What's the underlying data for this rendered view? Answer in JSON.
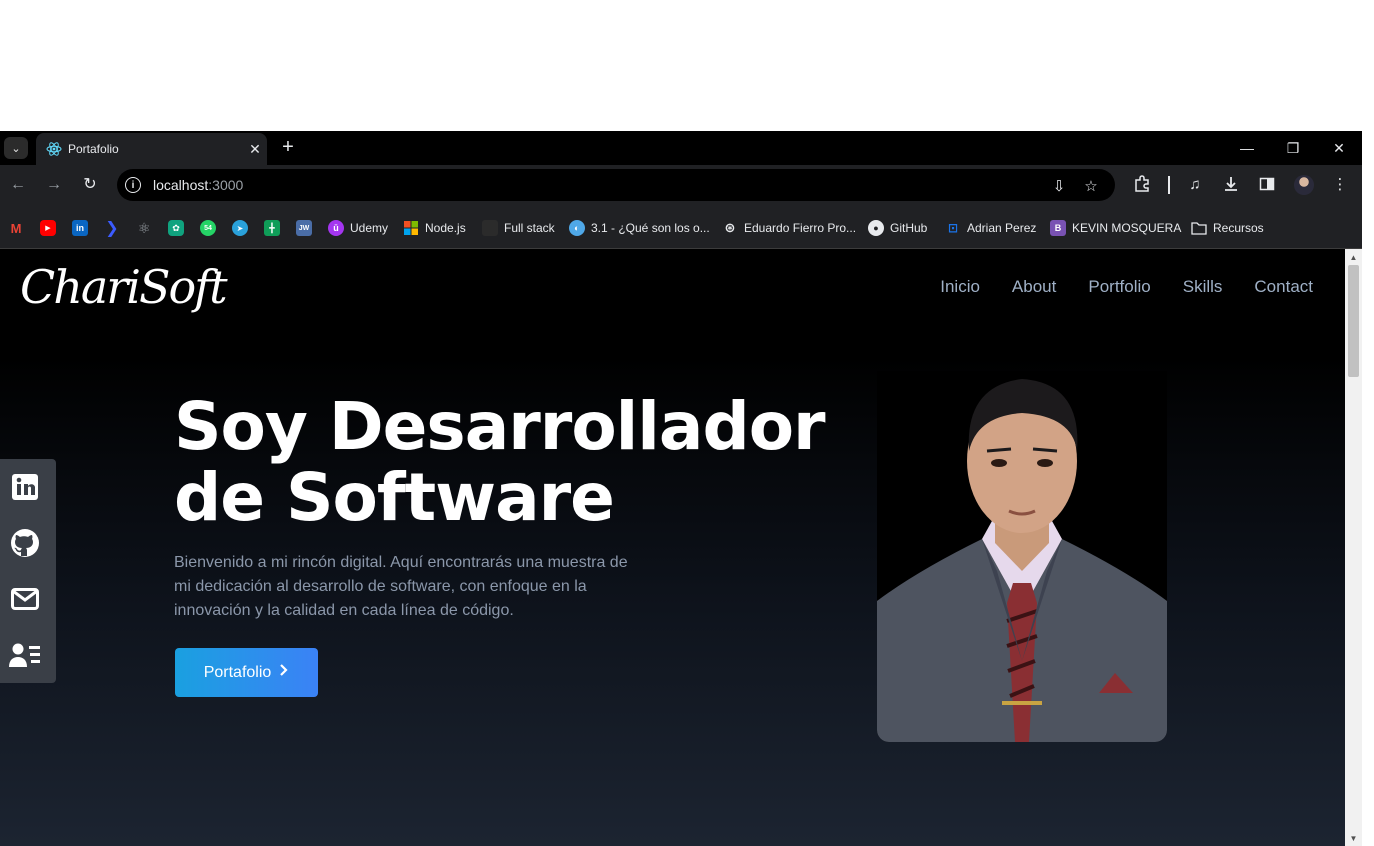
{
  "browser": {
    "tab": {
      "title": "Portafolio"
    },
    "url": {
      "host": "localhost",
      "port": ":3000"
    },
    "bookmarks": [
      {
        "label": "",
        "icon": "gmail-icon"
      },
      {
        "label": "",
        "icon": "youtube-icon"
      },
      {
        "label": "",
        "icon": "linkedin-icon"
      },
      {
        "label": "",
        "icon": "chevron-app-icon"
      },
      {
        "label": "",
        "icon": "react-icon"
      },
      {
        "label": "",
        "icon": "chatgpt-icon"
      },
      {
        "label": "",
        "icon": "whatsapp-icon"
      },
      {
        "label": "",
        "icon": "telegram-icon"
      },
      {
        "label": "",
        "icon": "sheets-icon"
      },
      {
        "label": "",
        "icon": "jw-icon"
      },
      {
        "label": "Udemy",
        "icon": "udemy-icon"
      },
      {
        "label": "Node.js",
        "icon": "microsoft-icon"
      },
      {
        "label": "Full stack",
        "icon": "square-icon"
      },
      {
        "label": "3.1 - ¿Qué son los o...",
        "icon": "circle-icon"
      },
      {
        "label": "Eduardo Fierro Pro...",
        "icon": "openai-icon"
      },
      {
        "label": "GitHub",
        "icon": "github-icon"
      },
      {
        "label": "Adrian Perez",
        "icon": "classroom-icon"
      },
      {
        "label": "KEVIN MOSQUERA",
        "icon": "bootstrap-icon"
      },
      {
        "label": "Recursos",
        "icon": "folder-icon"
      }
    ]
  },
  "site": {
    "logo": "ChariSoft",
    "nav": [
      "Inicio",
      "About",
      "Portfolio",
      "Skills",
      "Contact"
    ],
    "hero": {
      "title_line1": "Soy Desarrollador",
      "title_line2": "de Software",
      "description": "Bienvenido a mi rincón digital. Aquí encontrarás una muestra de mi dedicación al desarrollo de software, con enfoque en la innovación y la calidad en cada línea de código.",
      "cta": "Portafolio"
    },
    "social": [
      "linkedin-icon",
      "github-icon",
      "mail-icon",
      "resume-icon"
    ]
  },
  "colors": {
    "accent_start": "#1aa0e0",
    "accent_end": "#3b82f6",
    "nav_text": "#9fb0c6"
  }
}
